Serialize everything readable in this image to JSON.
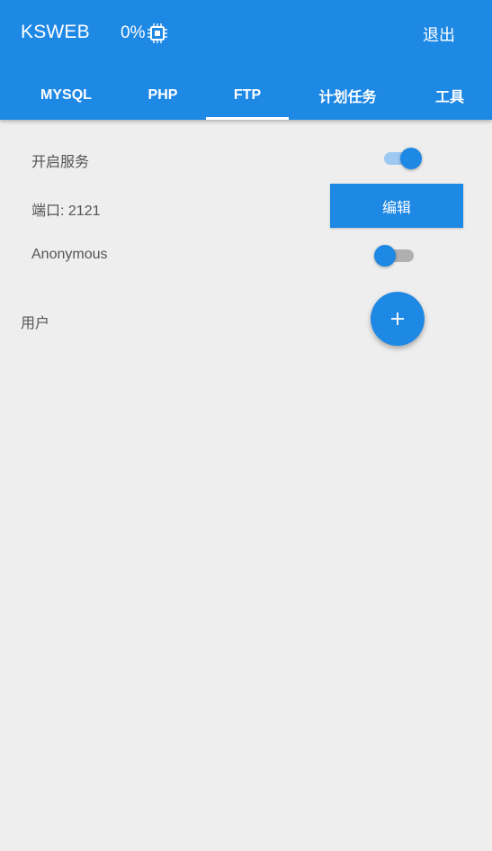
{
  "header": {
    "title": "KSWEB",
    "cpu_usage": "0%",
    "exit_label": "退出"
  },
  "tabs": [
    {
      "label": "MYSQL",
      "active": false
    },
    {
      "label": "PHP",
      "active": false
    },
    {
      "label": "FTP",
      "active": true
    },
    {
      "label": "计划任务",
      "active": false
    },
    {
      "label": "工具",
      "active": false
    }
  ],
  "ftp": {
    "service_label": "开启服务",
    "service_enabled": true,
    "port_label": "端口",
    "port_value": ": 2121",
    "edit_label": "编辑",
    "anonymous_label": "Anonymous",
    "anonymous_enabled": false,
    "users_label": "用户"
  },
  "colors": {
    "primary": "#1e88e5",
    "background": "#eeeeee",
    "text": "#555555"
  },
  "icons": {
    "cpu": "cpu-chip-icon",
    "add": "plus-icon"
  }
}
